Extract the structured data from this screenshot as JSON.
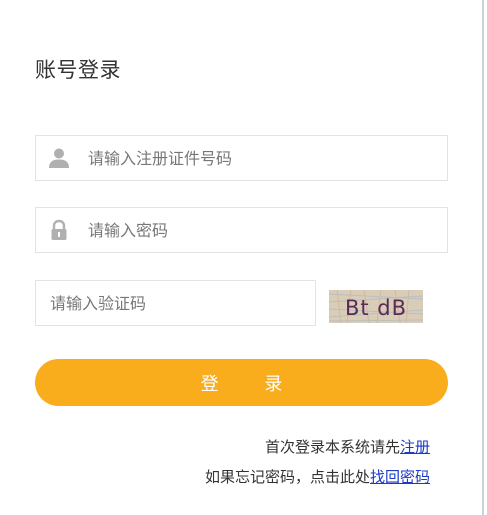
{
  "login": {
    "title": "账号登录",
    "account_placeholder": "请输入注册证件号码",
    "password_placeholder": "请输入密码",
    "captcha_placeholder": "请输入验证码",
    "captcha_text": "Bt dB",
    "submit_label": "登 录",
    "register_prompt": "首次登录本系统请先",
    "register_link": "注册",
    "forgot_prompt": "如果忘记密码，点击此处",
    "forgot_link": "找回密码"
  },
  "colors": {
    "accent": "#f9ad1d",
    "link": "#1c39c8",
    "icon": "#b0b0b0"
  },
  "icons": {
    "account": "user-icon",
    "password": "lock-icon"
  }
}
